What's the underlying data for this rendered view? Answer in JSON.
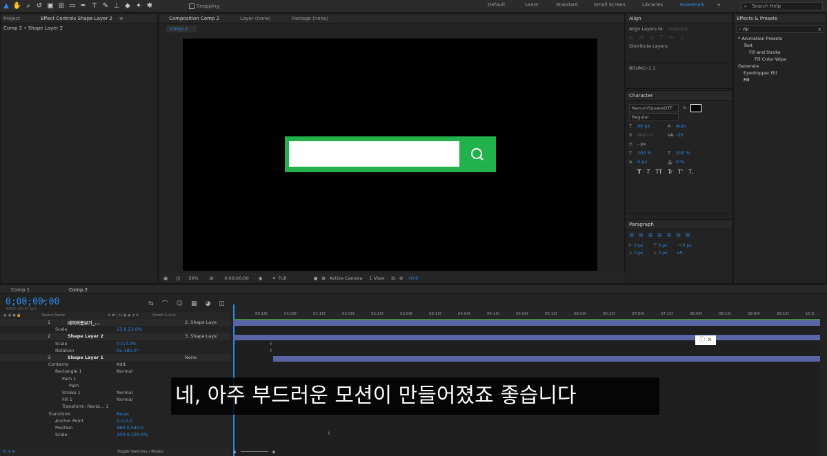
{
  "toolbar": {
    "snapping_label": "Snapping",
    "workspaces": [
      "Default",
      "Learn",
      "Standard",
      "Small Screen",
      "Libraries",
      "Essentials"
    ],
    "active_workspace": "Essentials",
    "search_placeholder": "Search Help"
  },
  "left_panel": {
    "tabs": [
      "Project",
      "Effect Controls Shape Layer 2"
    ],
    "breadcrumb": "Comp 2 • Shape Layer 2"
  },
  "comp_panel": {
    "tabs": [
      "Composition Comp 2",
      "Layer (none)",
      "Footage (none)"
    ],
    "comp_tab": "Comp 2",
    "footer": {
      "zoom": "50%",
      "timecode": "0;00;00;00",
      "resolution": "Full",
      "camera": "Active Camera",
      "view": "1 View",
      "exposure": "+0.0"
    }
  },
  "align_panel": {
    "title": "Align",
    "align_to_label": "Align Layers to:",
    "align_to_value": "Selection",
    "distribute_label": "Distribute Layers:",
    "bounce_label": "BOUNCr-1.1"
  },
  "character_panel": {
    "title": "Character",
    "font": "NanumSquareOTF",
    "style": "Regular",
    "size": "90 px",
    "leading": "Auto",
    "kerning": "Metrics",
    "tracking": "-25",
    "stroke": "- px",
    "vscale": "100 %",
    "hscale": "100 %",
    "baseline": "0 px",
    "tsume": "0 %",
    "styles": [
      "T",
      "T",
      "TT",
      "Tr",
      "T'",
      "T,"
    ]
  },
  "paragraph_panel": {
    "title": "Paragraph",
    "indent_left": "0 px",
    "indent_first": "0 px",
    "indent_right": "0 px",
    "space_before": "0 px",
    "space_after": "0 px"
  },
  "effects_panel": {
    "title": "Effects & Presets",
    "search": "fill",
    "tree": [
      {
        "label": "* Animation Presets",
        "indent": 0
      },
      {
        "label": "Text",
        "indent": 1
      },
      {
        "label": "Fill and Stroke",
        "indent": 2
      },
      {
        "label": "Fill Color Wipe",
        "indent": 3
      },
      {
        "label": "Generate",
        "indent": 0
      },
      {
        "label": "Eyedropper Fill",
        "indent": 1
      },
      {
        "label": "Fill",
        "indent": 1
      }
    ]
  },
  "timeline": {
    "tabs": [
      "Comp 1",
      "Comp 2"
    ],
    "timecode": "0;00;00;00",
    "fps": "00000 (29.97 fps)",
    "columns": {
      "source": "Source Name",
      "parent": "Parent & Link"
    },
    "ruler": [
      "00:15f",
      "01:00f",
      "01:15f",
      "02:00f",
      "02:15f",
      "03:00f",
      "03:15f",
      "04:00f",
      "04:15f",
      "05:00f",
      "05:15f",
      "06:00f",
      "06:15f",
      "07:00f",
      "07:15f",
      "08:00f",
      "08:15f",
      "09:00f",
      "09:15f",
      "10:0"
    ],
    "rows": [
      {
        "num": "1",
        "name": "네이버돋보기_...",
        "value": "",
        "parent": "2. Shape Laye",
        "indent": 0,
        "layer": true
      },
      {
        "num": "",
        "name": "Scale",
        "value": "23.0,23.0%",
        "parent": "",
        "indent": 2,
        "layer": false
      },
      {
        "num": "2",
        "name": "Shape Layer 2",
        "value": "",
        "parent": "3. Shape Laye",
        "indent": 0,
        "layer": true
      },
      {
        "num": "",
        "name": "Scale",
        "value": "0.0,0.0%",
        "parent": "",
        "indent": 2,
        "layer": false
      },
      {
        "num": "",
        "name": "Rotation",
        "value": "0x-180.0°",
        "parent": "",
        "indent": 2,
        "layer": false
      },
      {
        "num": "3",
        "name": "Shape Layer 1",
        "value": "",
        "parent": "None",
        "indent": 0,
        "layer": true
      },
      {
        "num": "",
        "name": "Contents",
        "value": "Add:",
        "parent": "",
        "indent": 1,
        "layer": false
      },
      {
        "num": "",
        "name": "Rectangle 1",
        "value": "Normal",
        "parent": "",
        "indent": 2,
        "layer": false
      },
      {
        "num": "",
        "name": "Path 1",
        "value": "",
        "parent": "",
        "indent": 3,
        "layer": false
      },
      {
        "num": "",
        "name": "Path",
        "value": "",
        "parent": "",
        "indent": 4,
        "layer": false
      },
      {
        "num": "",
        "name": "Stroke 1",
        "value": "Normal",
        "parent": "",
        "indent": 3,
        "layer": false
      },
      {
        "num": "",
        "name": "Fill 1",
        "value": "Normal",
        "parent": "",
        "indent": 3,
        "layer": false
      },
      {
        "num": "",
        "name": "Transform: Recta... 1",
        "value": "",
        "parent": "",
        "indent": 3,
        "layer": false
      },
      {
        "num": "",
        "name": "Transform",
        "value": "Reset",
        "parent": "",
        "indent": 1,
        "layer": false
      },
      {
        "num": "",
        "name": "Anchor Point",
        "value": "0.0,0.0",
        "parent": "",
        "indent": 2,
        "layer": false
      },
      {
        "num": "",
        "name": "Position",
        "value": "960.0,540.0",
        "parent": "",
        "indent": 2,
        "layer": false
      },
      {
        "num": "",
        "name": "Scale",
        "value": "100.0,100.0%",
        "parent": "",
        "indent": 2,
        "layer": false
      }
    ],
    "footer": "Toggle Switches / Modes"
  },
  "subtitle": "네, 아주 부드러운 모션이 만들어졌죠 좋습니다",
  "colors": {
    "accent": "#2d8ceb",
    "green": "#21b24b",
    "layerbar": "#5965a7"
  }
}
